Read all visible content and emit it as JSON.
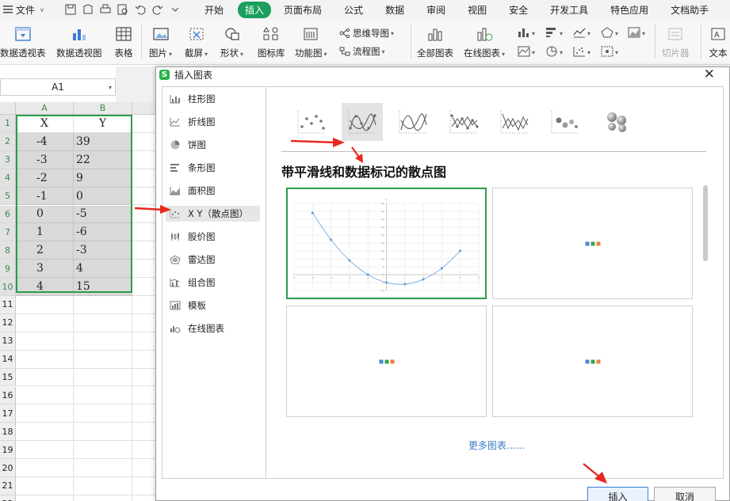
{
  "menubar": {
    "file_label": "文件",
    "tabs": [
      {
        "label": "开始",
        "active": false
      },
      {
        "label": "插入",
        "active": true
      },
      {
        "label": "页面布局",
        "active": false
      },
      {
        "label": "公式",
        "active": false
      },
      {
        "label": "数据",
        "active": false
      },
      {
        "label": "审阅",
        "active": false
      },
      {
        "label": "视图",
        "active": false
      },
      {
        "label": "安全",
        "active": false
      },
      {
        "label": "开发工具",
        "active": false
      },
      {
        "label": "特色应用",
        "active": false
      },
      {
        "label": "文档助手",
        "active": false
      }
    ]
  },
  "ribbon": {
    "pivot_table": "数据透视表",
    "pivot_chart": "数据透视图",
    "table": "表格",
    "picture": "图片",
    "screenshot": "截屏",
    "shapes": "形状",
    "icon_library": "图标库",
    "function_chart": "功能图",
    "mind_map": "思维导图",
    "flow_chart": "流程图",
    "all_charts": "全部图表",
    "online_charts": "在线图表",
    "slicer": "切片器",
    "textbox": "文本"
  },
  "formula_bar": {
    "name_box": "A1"
  },
  "sheet": {
    "columns": [
      "A",
      "B"
    ],
    "rows": [
      {
        "num": "1",
        "a": "X",
        "b": "Y"
      },
      {
        "num": "2",
        "a": "-4",
        "b": "39"
      },
      {
        "num": "3",
        "a": "-3",
        "b": "22"
      },
      {
        "num": "4",
        "a": "-2",
        "b": "9"
      },
      {
        "num": "5",
        "a": "-1",
        "b": "0"
      },
      {
        "num": "6",
        "a": "0",
        "b": "-5"
      },
      {
        "num": "7",
        "a": "1",
        "b": "-6"
      },
      {
        "num": "8",
        "a": "2",
        "b": "-3"
      },
      {
        "num": "9",
        "a": "3",
        "b": "4"
      },
      {
        "num": "10",
        "a": "4",
        "b": "15"
      },
      {
        "num": "11",
        "a": "",
        "b": ""
      },
      {
        "num": "12",
        "a": "",
        "b": ""
      },
      {
        "num": "13",
        "a": "",
        "b": ""
      },
      {
        "num": "14",
        "a": "",
        "b": ""
      },
      {
        "num": "15",
        "a": "",
        "b": ""
      },
      {
        "num": "16",
        "a": "",
        "b": ""
      },
      {
        "num": "17",
        "a": "",
        "b": ""
      },
      {
        "num": "18",
        "a": "",
        "b": ""
      },
      {
        "num": "19",
        "a": "",
        "b": ""
      },
      {
        "num": "20",
        "a": "",
        "b": ""
      },
      {
        "num": "21",
        "a": "",
        "b": ""
      },
      {
        "num": "22",
        "a": "",
        "b": ""
      },
      {
        "num": "23",
        "a": "",
        "b": ""
      },
      {
        "num": "24",
        "a": "",
        "b": ""
      },
      {
        "num": "25",
        "a": "",
        "b": ""
      },
      {
        "num": "26",
        "a": "",
        "b": ""
      }
    ]
  },
  "dialog": {
    "title": "插入图表",
    "categories": [
      {
        "label": "柱形图",
        "icon": "column-chart-icon",
        "active": false
      },
      {
        "label": "折线图",
        "icon": "line-chart-icon",
        "active": false
      },
      {
        "label": "饼图",
        "icon": "pie-chart-icon",
        "active": false
      },
      {
        "label": "条形图",
        "icon": "bar-chart-icon",
        "active": false
      },
      {
        "label": "面积图",
        "icon": "area-chart-icon",
        "active": false
      },
      {
        "label": "X Y（散点图）",
        "icon": "scatter-chart-icon",
        "active": true
      },
      {
        "label": "股价图",
        "icon": "stock-chart-icon",
        "active": false
      },
      {
        "label": "雷达图",
        "icon": "radar-chart-icon",
        "active": false
      },
      {
        "label": "组合图",
        "icon": "combo-chart-icon",
        "active": false
      },
      {
        "label": "模板",
        "icon": "template-icon",
        "active": false
      },
      {
        "label": "在线图表",
        "icon": "online-chart-icon",
        "active": false
      }
    ],
    "subtypes": [
      {
        "icon": "scatter-markers-icon",
        "active": false
      },
      {
        "icon": "scatter-smooth-markers-icon",
        "active": true
      },
      {
        "icon": "scatter-smooth-lines-icon",
        "active": false
      },
      {
        "icon": "scatter-straight-markers-icon",
        "active": false
      },
      {
        "icon": "scatter-straight-lines-icon",
        "active": false
      },
      {
        "icon": "bubble-icon",
        "active": false
      },
      {
        "icon": "bubble-3d-icon",
        "active": false
      }
    ],
    "heading": "带平滑线和数据标记的散点图",
    "more_charts": "更多图表......",
    "insert_button": "插入",
    "cancel_button": "取消",
    "preview_colors": [
      "#4a86d4",
      "#3aa14a",
      "#e8823a"
    ]
  },
  "chart_data": {
    "type": "scatter",
    "title": "",
    "xlabel": "",
    "ylabel": "Y",
    "x": [
      -4,
      -3,
      -2,
      -1,
      0,
      1,
      2,
      3,
      4
    ],
    "series": [
      {
        "values": [
          39,
          22,
          9,
          0,
          -5,
          -6,
          -3,
          4,
          15
        ]
      }
    ],
    "xlim": [
      -5,
      5
    ],
    "ylim": [
      -10,
      45
    ],
    "grid": true,
    "line": "smooth",
    "markers": true
  }
}
